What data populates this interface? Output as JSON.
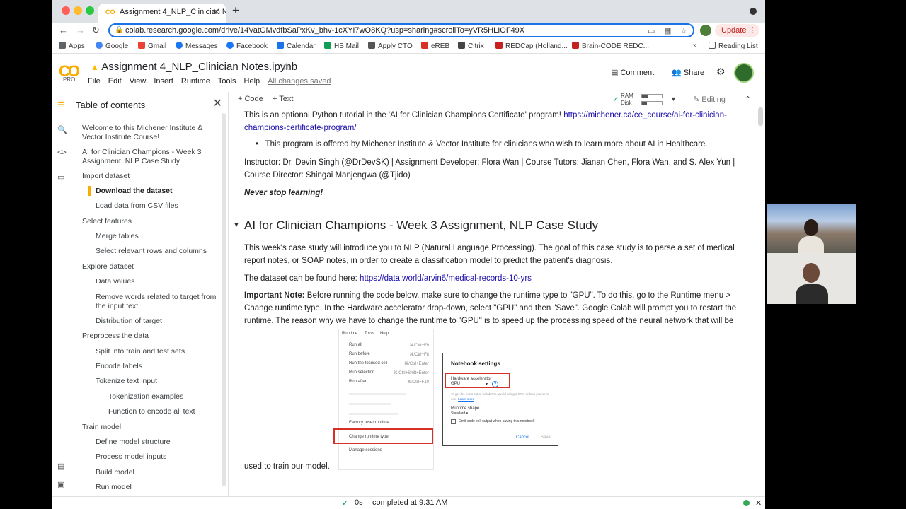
{
  "browser": {
    "tab_title": "Assignment 4_NLP_Clinician N",
    "tab_favicon": "CO",
    "url": "colab.research.google.com/drive/14VatGMvdfbSaPxKv_bhv-1cXYI7wO8KQ?usp=sharing#scrollTo=yVR5HLIOF49X",
    "update_label": "Update",
    "bookmarks": [
      "Apps",
      "Google",
      "Gmail",
      "Messages",
      "Facebook",
      "Calendar",
      "HB Mail",
      "Apply CTO",
      "eREB",
      "Citrix",
      "REDCap (Holland...",
      "Brain-CODE REDC..."
    ],
    "reading_list": "Reading List",
    "more": "»"
  },
  "colab": {
    "logo": "CO",
    "pro": "PRO",
    "notebook_title": "Assignment 4_NLP_Clinician Notes.ipynb",
    "menus": [
      "File",
      "Edit",
      "View",
      "Insert",
      "Runtime",
      "Tools",
      "Help"
    ],
    "saved_status": "All changes saved",
    "comment": "Comment",
    "share": "Share"
  },
  "toc": {
    "title": "Table of contents",
    "items": [
      {
        "label": "Welcome to this Michener Institute & Vector Institute Course!"
      },
      {
        "label": "AI for Clinician Champions - Week 3 Assignment, NLP Case Study"
      },
      {
        "label": "Import dataset"
      },
      {
        "label": "Download the dataset",
        "active": true
      },
      {
        "label": "Load data from CSV files"
      },
      {
        "label": "Select features"
      },
      {
        "label": "Merge tables"
      },
      {
        "label": "Select relevant rows and columns"
      },
      {
        "label": "Explore dataset"
      },
      {
        "label": "Data values"
      },
      {
        "label": "Remove words related to target from the input text"
      },
      {
        "label": "Distribution of target"
      },
      {
        "label": "Preprocess the data"
      },
      {
        "label": "Split into train and test sets"
      },
      {
        "label": "Encode labels"
      },
      {
        "label": "Tokenize text input"
      },
      {
        "label": "Tokenization examples"
      },
      {
        "label": "Function to encode all text"
      },
      {
        "label": "Train model"
      },
      {
        "label": "Define model structure"
      },
      {
        "label": "Process model inputs"
      },
      {
        "label": "Build model"
      },
      {
        "label": "Run model"
      }
    ]
  },
  "toolbar": {
    "add_code": "+ Code",
    "add_text": "+ Text",
    "ram": "RAM",
    "disk": "Disk",
    "editing": "Editing"
  },
  "notebook": {
    "intro_text": "This is an optional Python tutorial in the 'AI for Clinician Champions Certificate' program! ",
    "intro_link": "https://michener.ca/ce_course/ai-for-clinician-champions-certificate-program/",
    "bullet": "This program is offered by Michener Institute & Vector Institute for clinicians who wish to learn more about AI in Healthcare.",
    "instructors": "Instructor: Dr. Devin Singh (@DrDevSK) | Assignment Developer: Flora Wan | Course Tutors: Jianan Chen, Flora Wan, and S. Alex Yun | Course Director: Shingai Manjengwa (@Tjido)",
    "motto": "Never stop learning!",
    "heading": "AI for Clinician Champions - Week 3 Assignment, NLP Case Study",
    "case_text": "This week's case study will introduce you to NLP (Natural Language Processing). The goal of this case study is to parse a set of medical report notes, or SOAP notes, in order to create a classification model to predict the patient's diagnosis.",
    "dataset_prefix": "The dataset can be found here: ",
    "dataset_link": "https://data.world/arvin6/medical-records-10-yrs",
    "note_label": "Important Note:",
    "note_text": " Before running the code below, make sure to change the runtime type to \"GPU\". To do this, go to the Runtime menu > Change runtime type. In the Hardware accelerator drop-down, select \"GPU\" and then \"Save\". Google Colab will prompt you to restart the runtime. The reason why we have to change the runtime to \"GPU\" is to speed up the processing speed of the neural network that will be",
    "note_end": "used to train our model.",
    "screenshot": {
      "menu_bar": [
        "Runtime",
        "Tools",
        "Help"
      ],
      "items": [
        {
          "label": "Run all",
          "shortcut": "⌘/Ctrl+F9"
        },
        {
          "label": "Run before",
          "shortcut": "⌘/Ctrl+F8"
        },
        {
          "label": "Run the focused cell",
          "shortcut": "⌘/Ctrl+Enter"
        },
        {
          "label": "Run selection",
          "shortcut": "⌘/Ctrl+Shift+Enter"
        },
        {
          "label": "Run after",
          "shortcut": "⌘/Ctrl+F10"
        }
      ],
      "factory_reset": "Factory reset runtime",
      "change_runtime": "Change runtime type",
      "manage_sessions": "Manage sessions",
      "dialog_title": "Notebook settings",
      "hw_label": "Hardware accelerator",
      "hw_value": "GPU",
      "hw_note": "To get the most out of Colab Pro, avoid using a GPU unless you need one.",
      "learn_more": "Learn more",
      "shape_label": "Runtime shape",
      "shape_value": "Standard",
      "omit_label": "Omit code cell output when saving this notebook",
      "cancel": "Cancel",
      "save": "Save"
    }
  },
  "status": {
    "time": "0s",
    "completed": "completed at 9:31 AM"
  },
  "colors": {
    "accent": "#1a73e8",
    "colab_orange": "#f9ab00",
    "highlight_red": "#d93025"
  }
}
